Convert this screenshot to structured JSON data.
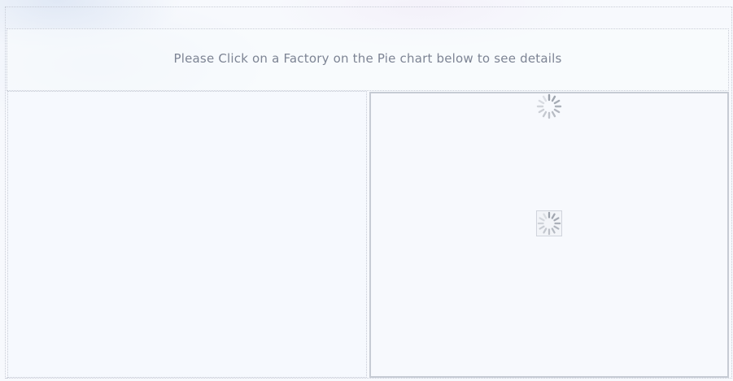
{
  "header": {
    "instruction": "Please Click on a Factory on the Pie chart below to see details"
  },
  "panels": {
    "left": {
      "state": "empty"
    },
    "right": {
      "state": "loading"
    }
  },
  "icons": {
    "loading": "loading-spinner-icon"
  },
  "colors": {
    "background": "#f7f9fd",
    "text": "#7d8494",
    "border": "#c6cbd4",
    "spinner": "#9aa0aa"
  }
}
